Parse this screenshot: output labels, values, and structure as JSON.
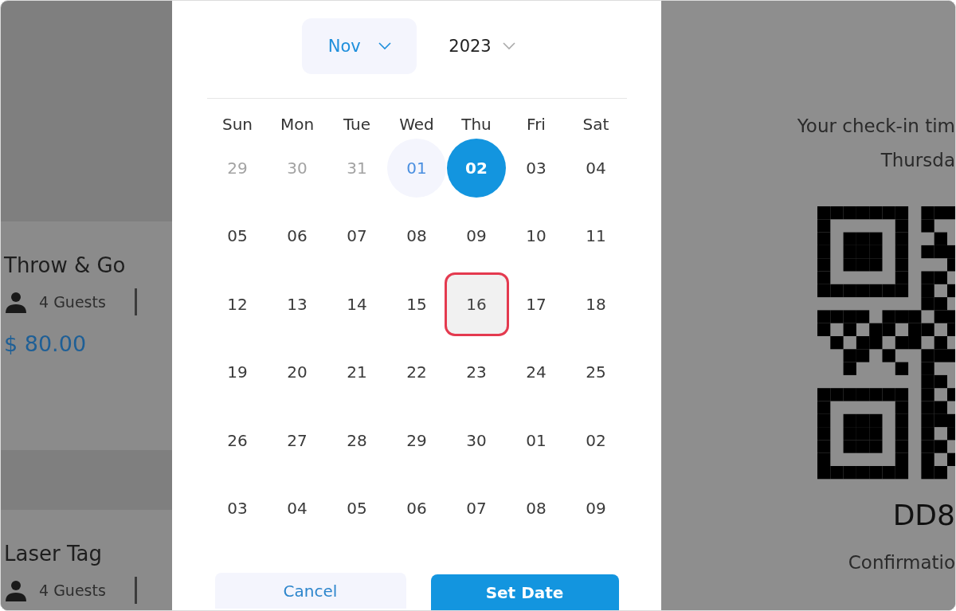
{
  "background": {
    "cards": [
      {
        "title": "Throw & Go",
        "guests": "4 Guests",
        "price": "$ 80.00"
      },
      {
        "title": "Laser Tag",
        "guests": "4 Guests"
      }
    ]
  },
  "date_picker": {
    "month": "Nov",
    "year": "2023",
    "weekdays": [
      "Sun",
      "Mon",
      "Tue",
      "Wed",
      "Thu",
      "Fri",
      "Sat"
    ],
    "days": [
      {
        "label": "29",
        "kind": "outside",
        "selected": false,
        "marked": false
      },
      {
        "label": "30",
        "kind": "outside",
        "selected": false,
        "marked": false
      },
      {
        "label": "31",
        "kind": "outside",
        "selected": false,
        "marked": false
      },
      {
        "label": "01",
        "kind": "today",
        "selected": false,
        "marked": false
      },
      {
        "label": "02",
        "kind": "normal",
        "selected": true,
        "marked": false
      },
      {
        "label": "03",
        "kind": "normal",
        "selected": false,
        "marked": false
      },
      {
        "label": "04",
        "kind": "normal",
        "selected": false,
        "marked": false
      },
      {
        "label": "05",
        "kind": "normal",
        "selected": false,
        "marked": false
      },
      {
        "label": "06",
        "kind": "normal",
        "selected": false,
        "marked": false
      },
      {
        "label": "07",
        "kind": "normal",
        "selected": false,
        "marked": false
      },
      {
        "label": "08",
        "kind": "normal",
        "selected": false,
        "marked": false
      },
      {
        "label": "09",
        "kind": "normal",
        "selected": false,
        "marked": false
      },
      {
        "label": "10",
        "kind": "normal",
        "selected": false,
        "marked": false
      },
      {
        "label": "11",
        "kind": "normal",
        "selected": false,
        "marked": false
      },
      {
        "label": "12",
        "kind": "normal",
        "selected": false,
        "marked": false
      },
      {
        "label": "13",
        "kind": "normal",
        "selected": false,
        "marked": false
      },
      {
        "label": "14",
        "kind": "normal",
        "selected": false,
        "marked": false
      },
      {
        "label": "15",
        "kind": "normal",
        "selected": false,
        "marked": false
      },
      {
        "label": "16",
        "kind": "hover",
        "selected": false,
        "marked": true
      },
      {
        "label": "17",
        "kind": "normal",
        "selected": false,
        "marked": false
      },
      {
        "label": "18",
        "kind": "normal",
        "selected": false,
        "marked": false
      },
      {
        "label": "19",
        "kind": "normal",
        "selected": false,
        "marked": false
      },
      {
        "label": "20",
        "kind": "normal",
        "selected": false,
        "marked": false
      },
      {
        "label": "21",
        "kind": "normal",
        "selected": false,
        "marked": false
      },
      {
        "label": "22",
        "kind": "normal",
        "selected": false,
        "marked": false
      },
      {
        "label": "23",
        "kind": "normal",
        "selected": false,
        "marked": false
      },
      {
        "label": "24",
        "kind": "normal",
        "selected": false,
        "marked": false
      },
      {
        "label": "25",
        "kind": "normal",
        "selected": false,
        "marked": false
      },
      {
        "label": "26",
        "kind": "normal",
        "selected": false,
        "marked": false
      },
      {
        "label": "27",
        "kind": "normal",
        "selected": false,
        "marked": false
      },
      {
        "label": "28",
        "kind": "normal",
        "selected": false,
        "marked": false
      },
      {
        "label": "29",
        "kind": "normal",
        "selected": false,
        "marked": false
      },
      {
        "label": "30",
        "kind": "normal",
        "selected": false,
        "marked": false
      },
      {
        "label": "01",
        "kind": "normal",
        "selected": false,
        "marked": false
      },
      {
        "label": "02",
        "kind": "normal",
        "selected": false,
        "marked": false
      },
      {
        "label": "03",
        "kind": "normal",
        "selected": false,
        "marked": false
      },
      {
        "label": "04",
        "kind": "normal",
        "selected": false,
        "marked": false
      },
      {
        "label": "05",
        "kind": "normal",
        "selected": false,
        "marked": false
      },
      {
        "label": "06",
        "kind": "normal",
        "selected": false,
        "marked": false
      },
      {
        "label": "07",
        "kind": "normal",
        "selected": false,
        "marked": false
      },
      {
        "label": "08",
        "kind": "normal",
        "selected": false,
        "marked": false
      },
      {
        "label": "09",
        "kind": "normal",
        "selected": false,
        "marked": false
      }
    ],
    "buttons": [
      {
        "label": "Cancel",
        "kind": "secondary"
      },
      {
        "label": "Set Date",
        "kind": "primary"
      }
    ]
  },
  "confirmation": {
    "check_in": "Your check-in tim",
    "day": "Thursda",
    "code": "DD8",
    "note": "Confirmatio"
  }
}
